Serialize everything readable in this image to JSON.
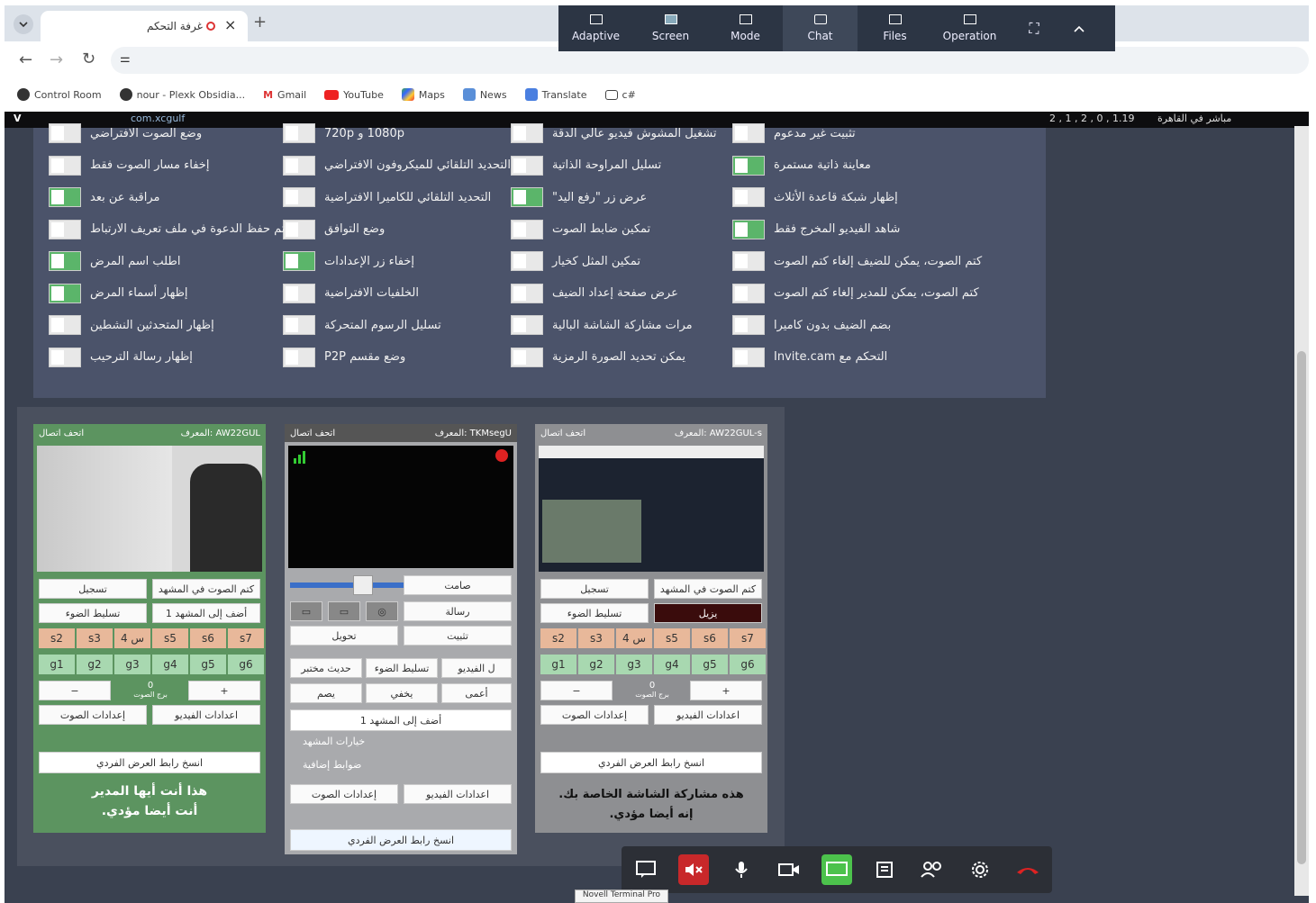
{
  "tab": {
    "title": "غرفة التحكم"
  },
  "bookmarks": [
    {
      "label": "Control Room"
    },
    {
      "label": "nour - Plexk Obsidia..."
    },
    {
      "label": "Gmail"
    },
    {
      "label": "YouTube"
    },
    {
      "label": "Maps"
    },
    {
      "label": "News"
    },
    {
      "label": "Translate"
    },
    {
      "label": "c#"
    }
  ],
  "remote_toolbar": [
    {
      "label": "Adaptive"
    },
    {
      "label": "Screen"
    },
    {
      "label": "Mode"
    },
    {
      "label": "Chat"
    },
    {
      "label": "Files"
    },
    {
      "label": "Operation"
    }
  ],
  "topbar": {
    "left": "V",
    "site": "com.xcgulf",
    "right_status": "2 , 1 , 2 , 0 , 1.19",
    "right_label": "مباشر في القاهرة"
  },
  "settings": {
    "col1": [
      {
        "label": "وضع الصوت الافتراضي",
        "on": false
      },
      {
        "label": "إخفاء مسار الصوت فقط",
        "on": false
      },
      {
        "label": "مراقبة عن بعد",
        "on": true
      },
      {
        "label": "تم حفظ الدعوة في ملف تعريف الارتباط",
        "on": false
      },
      {
        "label": "اطلب اسم المرض",
        "on": true
      },
      {
        "label": "إظهار أسماء المرض",
        "on": true
      },
      {
        "label": "إظهار المتحدثين النشطين",
        "on": false
      },
      {
        "label": "إظهار رسالة الترحيب",
        "on": false
      }
    ],
    "col2": [
      {
        "label": "1080p و 720p",
        "on": false
      },
      {
        "label": "التحديد التلقائي للميكروفون الافتراضي",
        "on": false
      },
      {
        "label": "التحديد التلقائي للكاميرا الافتراضية",
        "on": false
      },
      {
        "label": "وضع التوافق",
        "on": false
      },
      {
        "label": "إخفاء زر الإعدادات",
        "on": true
      },
      {
        "label": "الخلفيات الافتراضية",
        "on": false
      },
      {
        "label": "تسليل الرسوم المتحركة",
        "on": false
      },
      {
        "label": "وضع مقسم P2P",
        "on": false
      }
    ],
    "col3": [
      {
        "label": "تشغيل المشوش فيديو عالي الدقة",
        "on": false
      },
      {
        "label": "تسليل المراوحة الذاتية",
        "on": false
      },
      {
        "label": "عرض زر \"رفع اليد\"",
        "on": true
      },
      {
        "label": "تمكين ضابط الصوت",
        "on": false
      },
      {
        "label": "تمكين المثل كخيار",
        "on": false
      },
      {
        "label": "عرض صفحة إعداد الضيف",
        "on": false
      },
      {
        "label": "مرات مشاركة الشاشة البالية",
        "on": false
      },
      {
        "label": "يمكن تحديد الصورة الرمزية",
        "on": false
      }
    ],
    "col4": [
      {
        "label": "تثبيت غير مدعوم",
        "on": false
      },
      {
        "label": "معاينة ذاتية مستمرة",
        "on": true
      },
      {
        "label": "إظهار شبكة قاعدة الأثلاث",
        "on": false
      },
      {
        "label": "شاهد الفيديو المخرج فقط",
        "on": true
      },
      {
        "label": "كتم الصوت، يمكن للضيف إلغاء كتم الصوت",
        "on": false
      },
      {
        "label": "كتم الصوت، يمكن للمدير إلغاء كتم الصوت",
        "on": false
      },
      {
        "label": "بضم الضيف بدون كاميرا",
        "on": false
      },
      {
        "label": "التحكم مع Invite.cam",
        "on": false
      }
    ]
  },
  "panels": [
    {
      "header_right": "AW22GUL :المعرف",
      "header_left": "اتحف اتصال",
      "record": "تسجيل",
      "mute_scene": "كتم الصوت في المشهد",
      "highlight": "تسليط الضوء",
      "add_scene": "أضف إلى المشهد 1",
      "scenes_s": [
        "s2",
        "s3",
        "4 س",
        "s5",
        "s6",
        "s7"
      ],
      "scenes_g": [
        "g1",
        "g2",
        "g3",
        "g4",
        "g5",
        "g6"
      ],
      "vol": "0",
      "vol_label": "برج الصوت",
      "audio_settings": "إعدادات الصوت",
      "video_settings": "اعدادات الفيديو",
      "copy_link": "انسخ رابط العرض الفردي",
      "msg1": "هذا أنت أيها المدير",
      "msg2": "أنت أيضا مؤدي."
    },
    {
      "header_right": "TKMsegU :المعرف",
      "header_left": "اتحف اتصال",
      "mute": "صامت",
      "message": "رسالة",
      "transfer": "تحويل",
      "pin": "تثبيت",
      "change_order": "حديث مختبر",
      "highlight": "تسليط الضوء",
      "video_full": "ل الفيديو",
      "zoom": "يصم",
      "hide": "يخفي",
      "blind": "أعمى",
      "add_scene": "أضف إلى المشهد 1",
      "scene_options": "خيارات المشهد",
      "advanced": "ضوابط إضافية",
      "audio_settings": "إعدادات الصوت",
      "video_settings": "اعدادات الفيديو",
      "copy_link": "انسخ رابط العرض الفردي"
    },
    {
      "header_right": "AW22GUL-s :المعرف",
      "header_left": "اتحف اتصال",
      "record": "تسجيل",
      "mute_scene": "كتم الصوت في المشهد",
      "highlight": "تسليط الضوء",
      "remove": "يزيل",
      "scenes_s": [
        "s2",
        "s3",
        "4 س",
        "s5",
        "s6",
        "s7"
      ],
      "scenes_g": [
        "g1",
        "g2",
        "g3",
        "g4",
        "g5",
        "g6"
      ],
      "vol": "0",
      "vol_label": "برج الصوت",
      "audio_settings": "إعدادات الصوت",
      "video_settings": "اعدادات الفيديو",
      "copy_link": "انسخ رابط العرض الفردي",
      "msg1": "هذه مشاركة الشاشة الخاصة بك.",
      "msg2": "إنه أيضا مؤدي."
    }
  ],
  "tooltip": "Novell Terminal Pro",
  "colors": {
    "accent_green": "#5bb56a",
    "panel_green": "#5c9460",
    "dock_red": "#c8282a",
    "dock_green": "#4cc24c"
  }
}
